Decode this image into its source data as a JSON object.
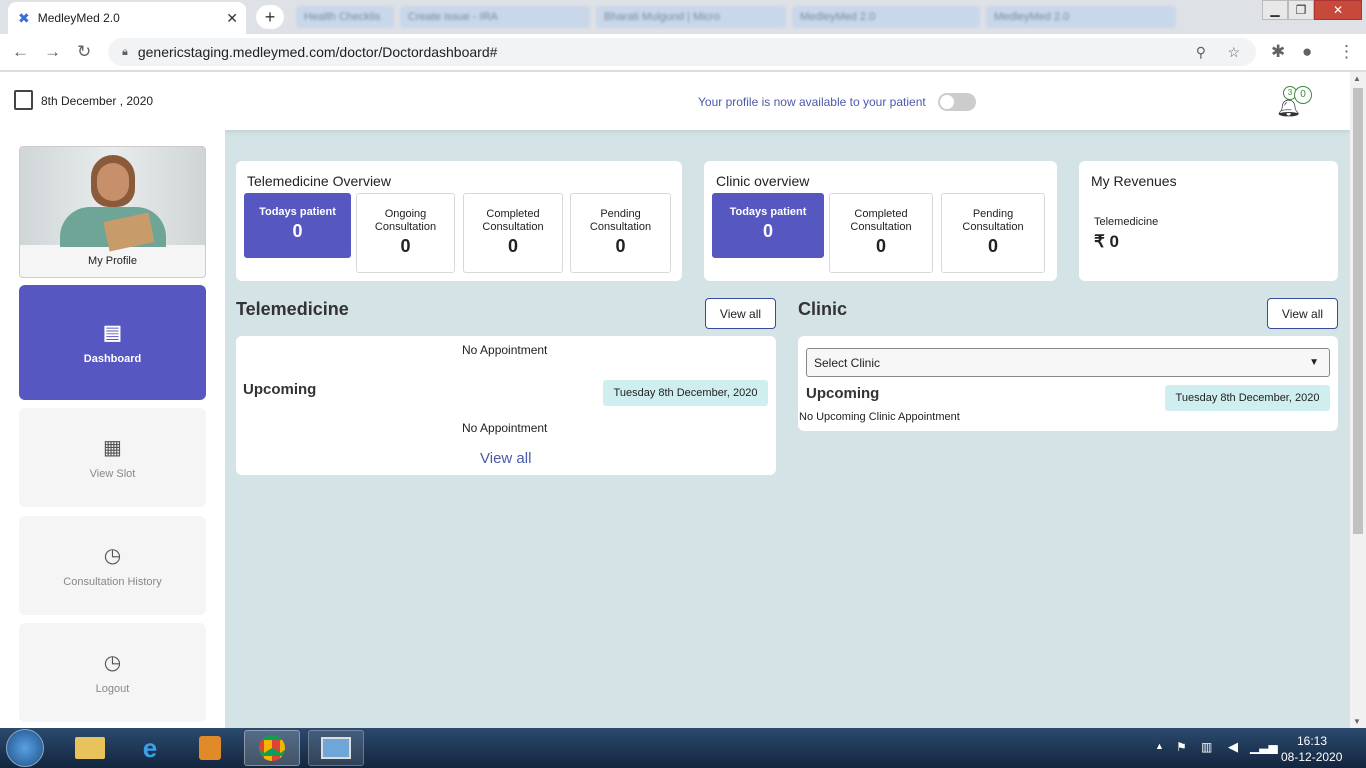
{
  "browser": {
    "active_tab_title": "MedleyMed 2.0",
    "bg_tabs": [
      "Health Checklis",
      "Create issue - IRA",
      "Bharati Mulgund | Micro",
      "MedleyMed 2.0",
      "MedleyMed 2.0"
    ],
    "url": "genericstaging.medleymed.com/doctor/Doctordashboard#"
  },
  "topbar": {
    "date": "8th December , 2020",
    "availability_text": "Your profile is now available to your patient",
    "notif_count_a": "3",
    "notif_count_b": "0"
  },
  "sidebar": {
    "profile_label": "My Profile",
    "items": [
      {
        "label": "Dashboard",
        "icon": "dashboard-icon"
      },
      {
        "label": "View Slot",
        "icon": "calendar-icon"
      },
      {
        "label": "Consultation History",
        "icon": "clipboard-clock-icon"
      },
      {
        "label": "Logout",
        "icon": "clipboard-clock-icon"
      }
    ]
  },
  "telemedicine_overview": {
    "title": "Telemedicine Overview",
    "stats": [
      {
        "label": "Todays patient",
        "value": "0"
      },
      {
        "label": "Ongoing Consultation",
        "value": "0"
      },
      {
        "label": "Completed Consultation",
        "value": "0"
      },
      {
        "label": "Pending Consultation",
        "value": "0"
      }
    ]
  },
  "clinic_overview": {
    "title": "Clinic overview",
    "stats": [
      {
        "label": "Todays patient",
        "value": "0"
      },
      {
        "label": "Completed Consultation",
        "value": "0"
      },
      {
        "label": "Pending Consultation",
        "value": "0"
      }
    ]
  },
  "revenues": {
    "title": "My Revenues",
    "label": "Telemedicine",
    "amount": "₹ 0"
  },
  "telemedicine": {
    "heading": "Telemedicine",
    "view_all": "View all",
    "no_appointment": "No Appointment",
    "upcoming": "Upcoming",
    "date": "Tuesday 8th December, 2020",
    "no_appointment_2": "No Appointment",
    "view_all_link": "View all"
  },
  "clinic": {
    "heading": "Clinic",
    "view_all": "View all",
    "select_placeholder": "Select Clinic",
    "upcoming": "Upcoming",
    "date": "Tuesday 8th December, 2020",
    "no_upcoming": "No Upcoming Clinic Appointment"
  },
  "taskbar": {
    "time": "16:13",
    "date": "08-12-2020"
  },
  "colors": {
    "accent": "#5657c0",
    "bg": "#d3e3e6",
    "pill": "#cfeeef"
  }
}
